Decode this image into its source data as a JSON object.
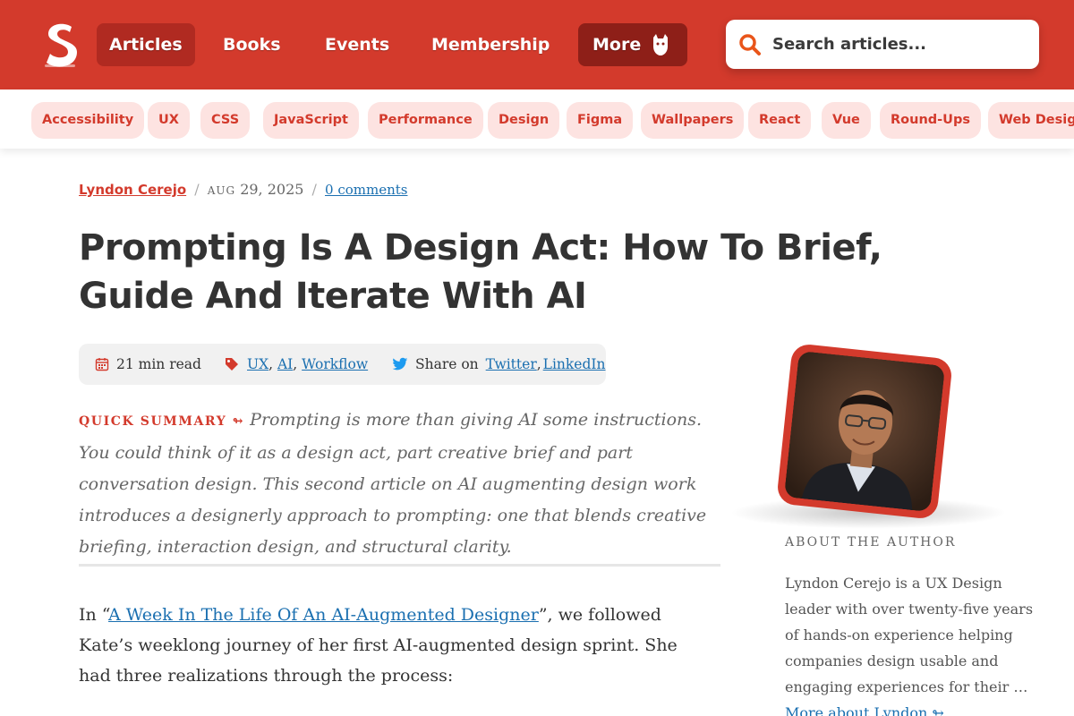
{
  "nav": {
    "items": [
      "Articles",
      "Books",
      "Events",
      "Membership"
    ],
    "more_label": "More",
    "search_placeholder": "Search articles..."
  },
  "tags": [
    "Accessibility",
    "UX",
    "CSS",
    "JavaScript",
    "Performance",
    "Design",
    "Figma",
    "Wallpapers",
    "React",
    "Vue",
    "Round-Ups",
    "Web Design"
  ],
  "article": {
    "author": "Lyndon Cerejo",
    "date_month": "AUG",
    "date_rest": "29, 2025",
    "comments": "0 comments",
    "title": "Prompting Is A Design Act: How To Brief, Guide And Iterate With AI",
    "read_time": "21 min read",
    "topics": [
      "UX",
      "AI",
      "Workflow"
    ],
    "share_label": "Share on",
    "share_links": [
      "Twitter",
      "LinkedIn"
    ],
    "summary_label": "QUICK SUMMARY ↬",
    "summary_text": "Prompting is more than giving AI some instructions. You could think of it as a design act, part creative brief and part conversation design. This second article on AI augmenting design work introduces a designerly approach to prompting: one that blends creative briefing, interaction design, and structural clarity.",
    "body_intro_pre": "In “",
    "body_link": "A Week In The Life Of An AI-Augmented Designer",
    "body_intro_post": "”, we followed Kate’s weeklong journey of her first AI-augmented design sprint. She had three realizations through the process:"
  },
  "sidebar": {
    "about_label": "ABOUT THE AUTHOR",
    "bio": "Lyndon Cerejo is a UX Design leader with over twenty-five years of hands-on experience helping companies design usable and engaging experiences for their … ",
    "more_link": "More about Lyndon ↬"
  },
  "colors": {
    "brand_red": "#d33a2c",
    "tag_bg": "#fde3e1",
    "link_blue": "#1a6fb0"
  }
}
